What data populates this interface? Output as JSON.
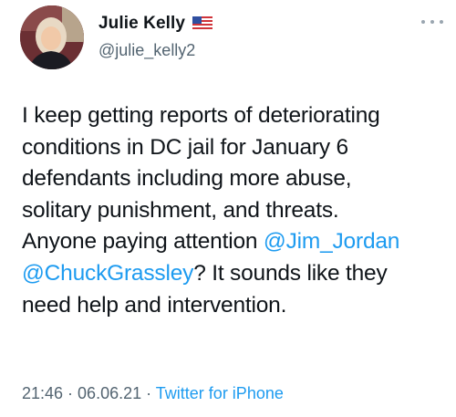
{
  "author": {
    "display_name": "Julie Kelly",
    "handle": "@julie_kelly2",
    "flag_icon": "us-flag-icon"
  },
  "tweet": {
    "lines": [
      "I keep getting reports of deteriorating",
      "conditions in DC jail for January 6",
      "defendants including more abuse,",
      "solitary punishment, and threats.",
      "Anyone paying attention ",
      "@Jim_Jordan",
      "@ChuckGrassley",
      "? It sounds like they",
      "need help and intervention."
    ]
  },
  "meta": {
    "time": "21:46",
    "sep1": " · ",
    "date": "06.06.21",
    "sep2": " · ",
    "source": "Twitter for iPhone"
  },
  "colors": {
    "link": "#1d9bf0",
    "text": "#0f1419",
    "muted": "#536471"
  }
}
